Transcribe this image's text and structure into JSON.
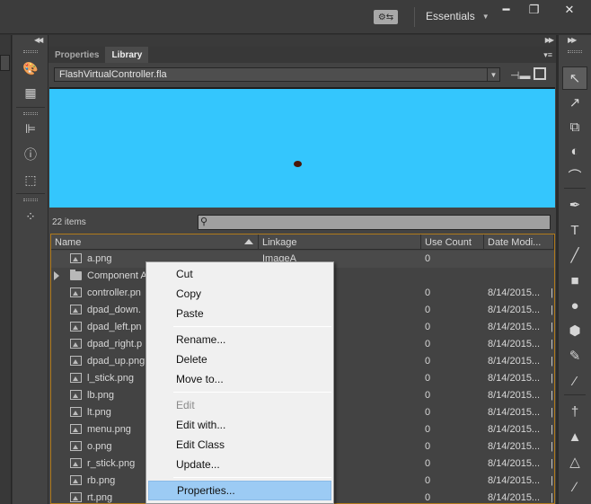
{
  "window": {
    "workspace_label": "Essentials",
    "sync_icon": "sync-settings-icon",
    "minimize": "━",
    "restore": "❐",
    "close": "✕"
  },
  "panel": {
    "tabs": [
      {
        "label": "Properties",
        "active": false
      },
      {
        "label": "Library",
        "active": true
      }
    ],
    "document": "FlashVirtualController.fla",
    "preview_color": "#34c6fd",
    "item_count": "22 items",
    "search_placeholder": ""
  },
  "columns": [
    "Name",
    "Linkage",
    "Use Count",
    "Date Modi..."
  ],
  "items": [
    {
      "name": "a.png",
      "linkage": "ImageA",
      "use": "0",
      "date": "",
      "type": "bitmap"
    },
    {
      "name": "Component A",
      "linkage": "",
      "use": "",
      "date": "",
      "type": "folder"
    },
    {
      "name": "controller.pn",
      "linkage": "r",
      "use": "0",
      "date": "8/14/2015...",
      "type": "bitmap"
    },
    {
      "name": "dpad_down.",
      "linkage": "vn",
      "use": "0",
      "date": "8/14/2015...",
      "type": "bitmap"
    },
    {
      "name": "dpad_left.pn",
      "linkage": "",
      "use": "0",
      "date": "8/14/2015...",
      "type": "bitmap"
    },
    {
      "name": "dpad_right.p",
      "linkage": "nt",
      "use": "0",
      "date": "8/14/2015...",
      "type": "bitmap"
    },
    {
      "name": "dpad_up.png",
      "linkage": "",
      "use": "0",
      "date": "8/14/2015...",
      "type": "bitmap"
    },
    {
      "name": "l_stick.png",
      "linkage": "",
      "use": "0",
      "date": "8/14/2015...",
      "type": "bitmap"
    },
    {
      "name": "lb.png",
      "linkage": "",
      "use": "0",
      "date": "8/14/2015...",
      "type": "bitmap"
    },
    {
      "name": "lt.png",
      "linkage": "",
      "use": "0",
      "date": "8/14/2015...",
      "type": "bitmap"
    },
    {
      "name": "menu.png",
      "linkage": "",
      "use": "0",
      "date": "8/14/2015...",
      "type": "bitmap"
    },
    {
      "name": "o.png",
      "linkage": "",
      "use": "0",
      "date": "8/14/2015...",
      "type": "bitmap"
    },
    {
      "name": "r_stick.png",
      "linkage": "",
      "use": "0",
      "date": "8/14/2015...",
      "type": "bitmap"
    },
    {
      "name": "rb.png",
      "linkage": "",
      "use": "0",
      "date": "8/14/2015...",
      "type": "bitmap"
    },
    {
      "name": "rt.png",
      "linkage": "",
      "use": "0",
      "date": "8/14/2015...",
      "type": "bitmap"
    }
  ],
  "context_menu": {
    "items": [
      {
        "label": "Cut",
        "enabled": true
      },
      {
        "label": "Copy",
        "enabled": true
      },
      {
        "label": "Paste",
        "enabled": true
      },
      {
        "label": "Rename...",
        "enabled": true
      },
      {
        "label": "Delete",
        "enabled": true
      },
      {
        "label": "Move to...",
        "enabled": true
      },
      {
        "label": "Edit",
        "enabled": false
      },
      {
        "label": "Edit with...",
        "enabled": true
      },
      {
        "label": "Edit Class",
        "enabled": true
      },
      {
        "label": "Update...",
        "enabled": true
      },
      {
        "label": "Properties...",
        "enabled": true,
        "highlighted": true
      }
    ]
  },
  "tools": [
    {
      "name": "selection-tool",
      "glyph": "↖",
      "active": true
    },
    {
      "name": "subselection-tool",
      "glyph": "↗",
      "active": false
    },
    {
      "name": "free-transform-tool",
      "glyph": "⧉",
      "active": false
    },
    {
      "name": "3d-rotation-tool",
      "glyph": "◐",
      "active": false
    },
    {
      "name": "lasso-tool",
      "glyph": "⌒",
      "active": false
    },
    {
      "name": "pen-tool",
      "glyph": "✒",
      "active": false
    },
    {
      "name": "text-tool",
      "glyph": "T",
      "active": false
    },
    {
      "name": "line-tool",
      "glyph": "╱",
      "active": false
    },
    {
      "name": "rectangle-tool",
      "glyph": "■",
      "active": false
    },
    {
      "name": "oval-tool",
      "glyph": "●",
      "active": false
    },
    {
      "name": "polystar-tool",
      "glyph": "⬢",
      "active": false
    },
    {
      "name": "pencil-tool",
      "glyph": "✎",
      "active": false
    },
    {
      "name": "brush-tool",
      "glyph": "⁄",
      "active": false
    },
    {
      "name": "bone-tool",
      "glyph": "†",
      "active": false
    },
    {
      "name": "paint-bucket-tool",
      "glyph": "▲",
      "active": false
    },
    {
      "name": "ink-bottle-tool",
      "glyph": "△",
      "active": false
    },
    {
      "name": "eyedropper-tool",
      "glyph": "∕",
      "active": false
    }
  ]
}
